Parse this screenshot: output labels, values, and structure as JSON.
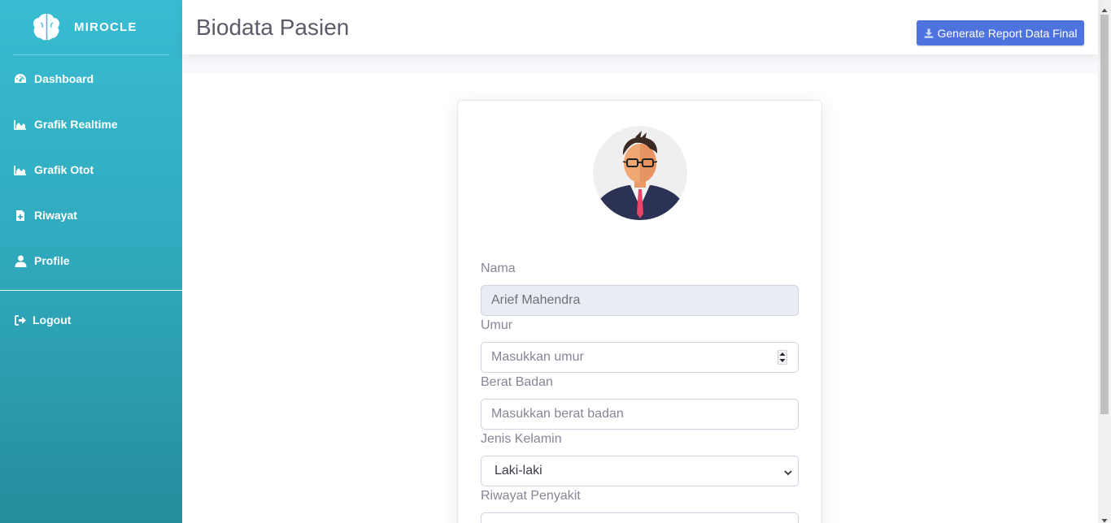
{
  "sidebar": {
    "brand": "MIROCLE",
    "items": [
      {
        "label": "Dashboard",
        "icon": "gauge-icon"
      },
      {
        "label": "Grafik Realtime",
        "icon": "area-chart-icon"
      },
      {
        "label": "Grafik Otot",
        "icon": "area-chart-icon"
      },
      {
        "label": "Riwayat",
        "icon": "file-medical-icon"
      },
      {
        "label": "Profile",
        "icon": "user-icon"
      }
    ],
    "logout": {
      "label": "Logout",
      "icon": "sign-out-icon"
    }
  },
  "header": {
    "title": "Biodata Pasien",
    "report_button": "Generate Report Data Final",
    "report_icon": "download-icon"
  },
  "form": {
    "nama": {
      "label": "Nama",
      "value": "Arief Mahendra"
    },
    "umur": {
      "label": "Umur",
      "placeholder": "Masukkan umur"
    },
    "berat": {
      "label": "Berat Badan",
      "placeholder": "Masukkan berat badan"
    },
    "jenis_kelamin": {
      "label": "Jenis Kelamin",
      "value": "Laki-laki"
    },
    "riwayat": {
      "label": "Riwayat Penyakit"
    }
  },
  "colors": {
    "sidebar_top": "#38bdd2",
    "sidebar_bottom": "#258d9c",
    "primary_button": "#4e73df",
    "title_text": "#5a5c69"
  }
}
